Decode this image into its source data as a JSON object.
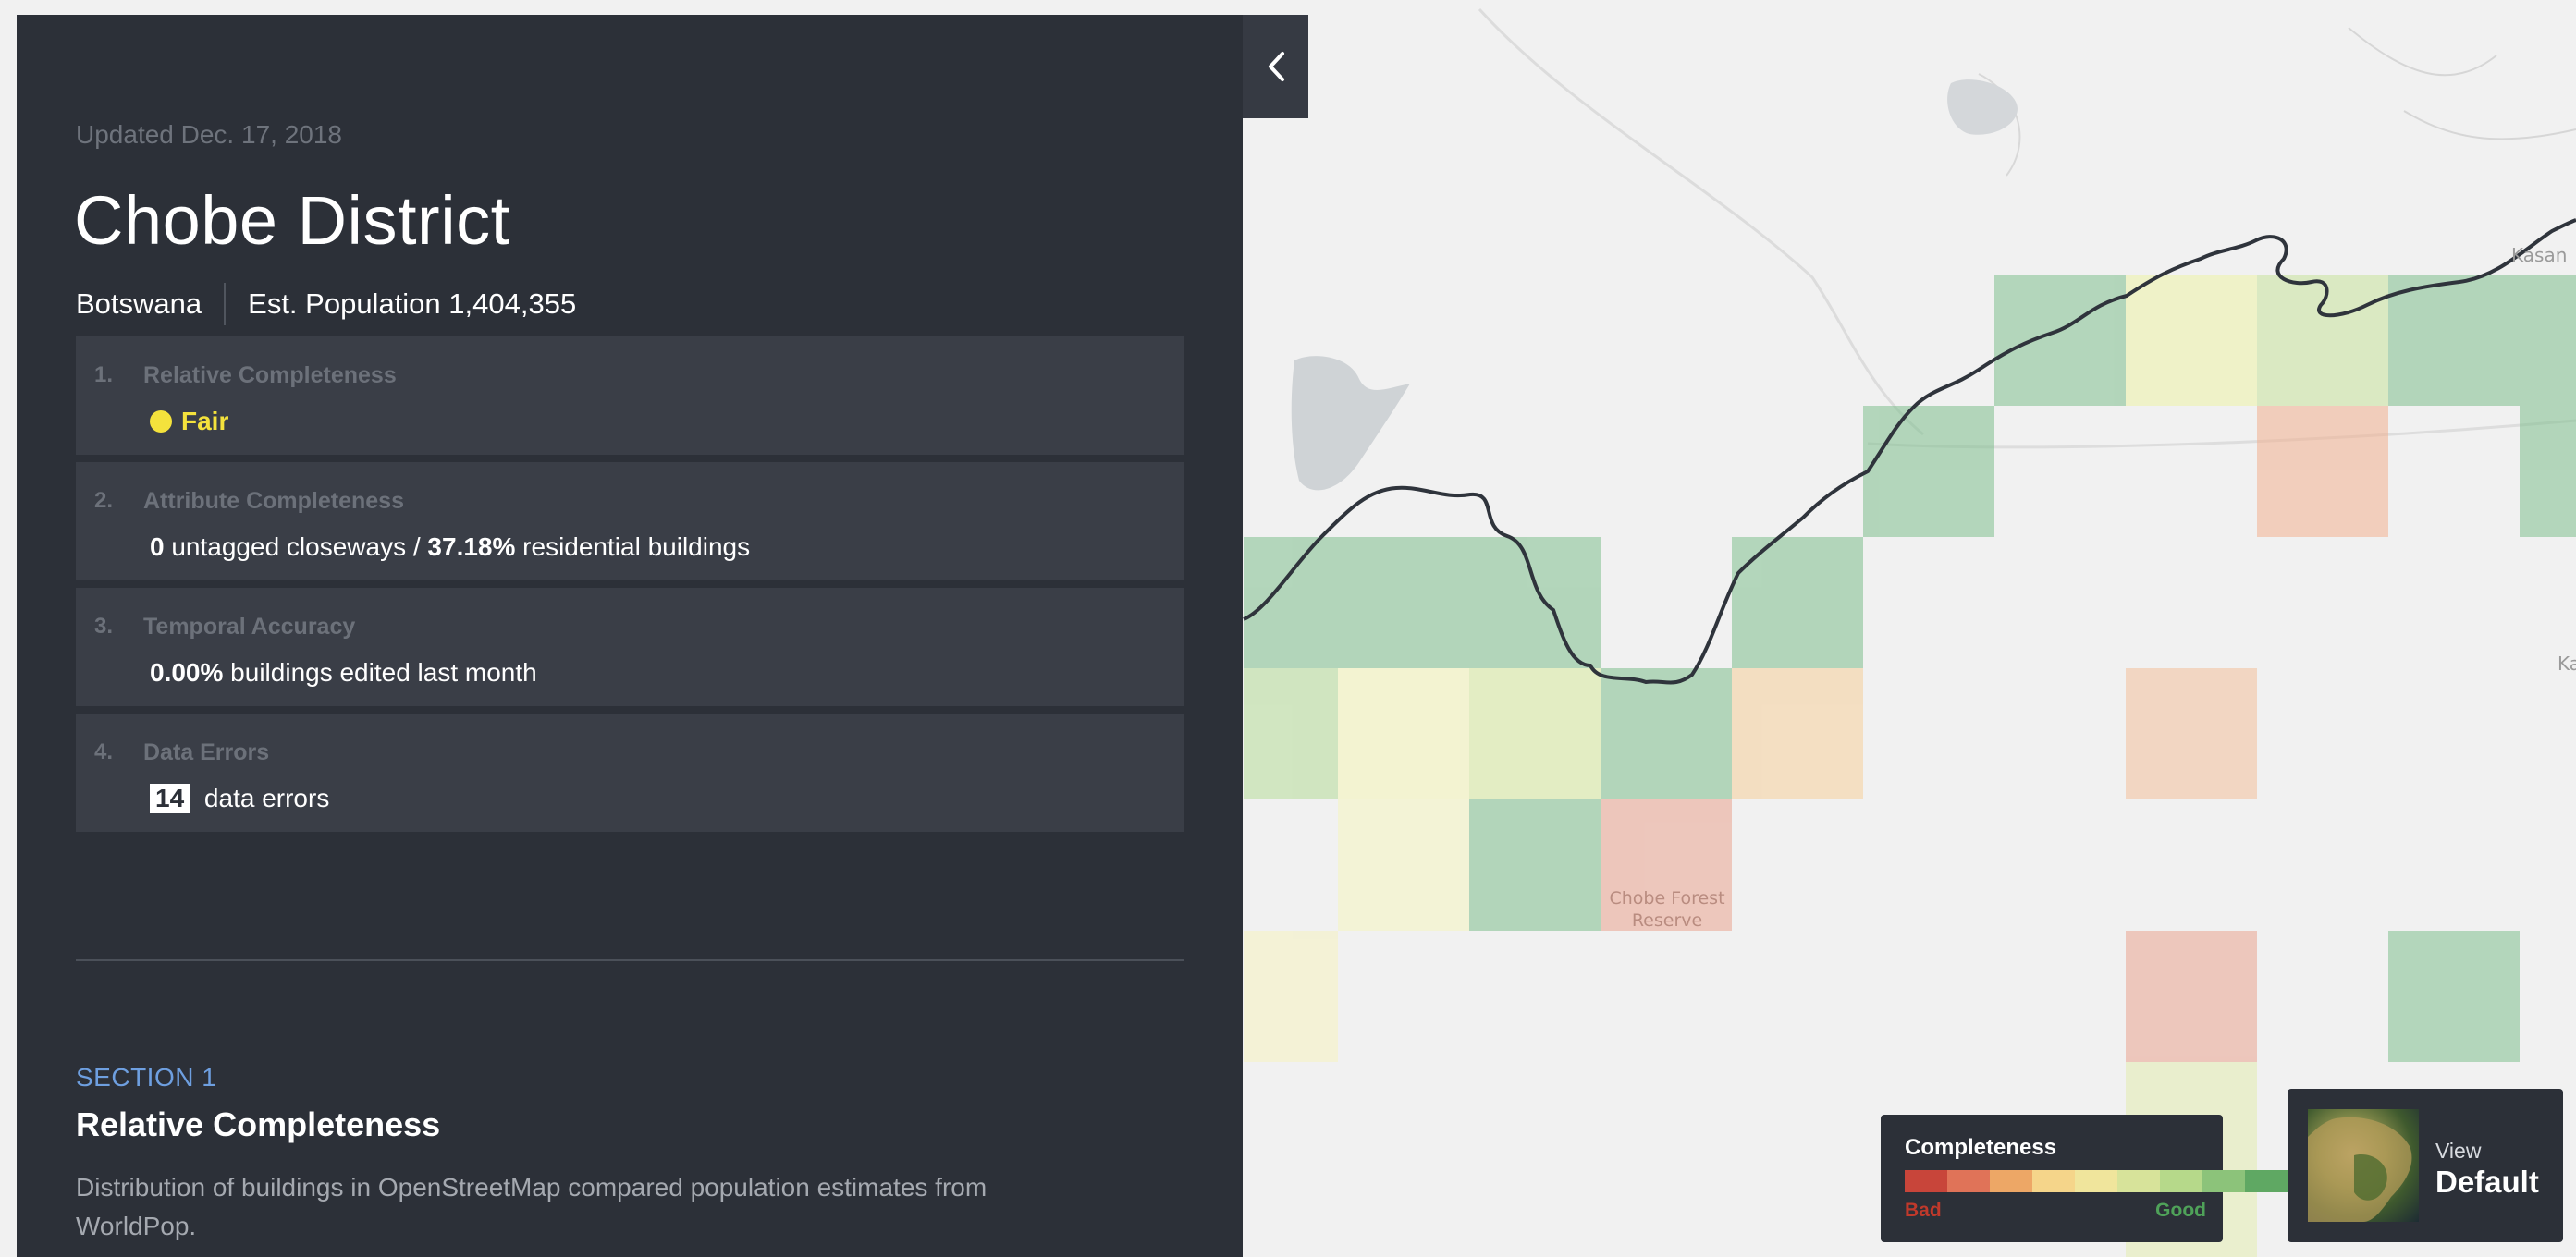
{
  "sidebar": {
    "updated": "Updated Dec. 17, 2018",
    "title": "Chobe District",
    "country": "Botswana",
    "population": "Est. Population 1,404,355",
    "cards": [
      {
        "num": "1.",
        "title": "Relative Completeness",
        "status": "Fair",
        "status_color": "#f4e23c"
      },
      {
        "num": "2.",
        "title": "Attribute Completeness",
        "v1": "0",
        "t1": " untagged closeways / ",
        "v2": "37.18%",
        "t2": " residential buildings"
      },
      {
        "num": "3.",
        "title": "Temporal Accuracy",
        "v1": "0.00%",
        "t1": " buildings edited last month"
      },
      {
        "num": "4.",
        "title": "Data Errors",
        "v1": "14",
        "t1": " data errors"
      }
    ],
    "section": {
      "label": "SECTION 1",
      "title": "Relative Completeness",
      "desc": "Distribution of buildings in OpenStreetMap compared population estimates from WorldPop."
    }
  },
  "map": {
    "labels": {
      "reserve": "Chobe Forest Reserve",
      "kasane": "Kasan",
      "ka": "Ka"
    }
  },
  "legend": {
    "title": "Completeness",
    "bad": "Bad",
    "good": "Good",
    "colors": [
      "#c8453a",
      "#e07358",
      "#eda766",
      "#f5d58a",
      "#f0e59c",
      "#d7e39a",
      "#b6d98a",
      "#8cc37a",
      "#5fa863"
    ]
  },
  "view": {
    "label": "View",
    "value": "Default"
  },
  "icons": {
    "collapse": "chevron-left-icon"
  }
}
